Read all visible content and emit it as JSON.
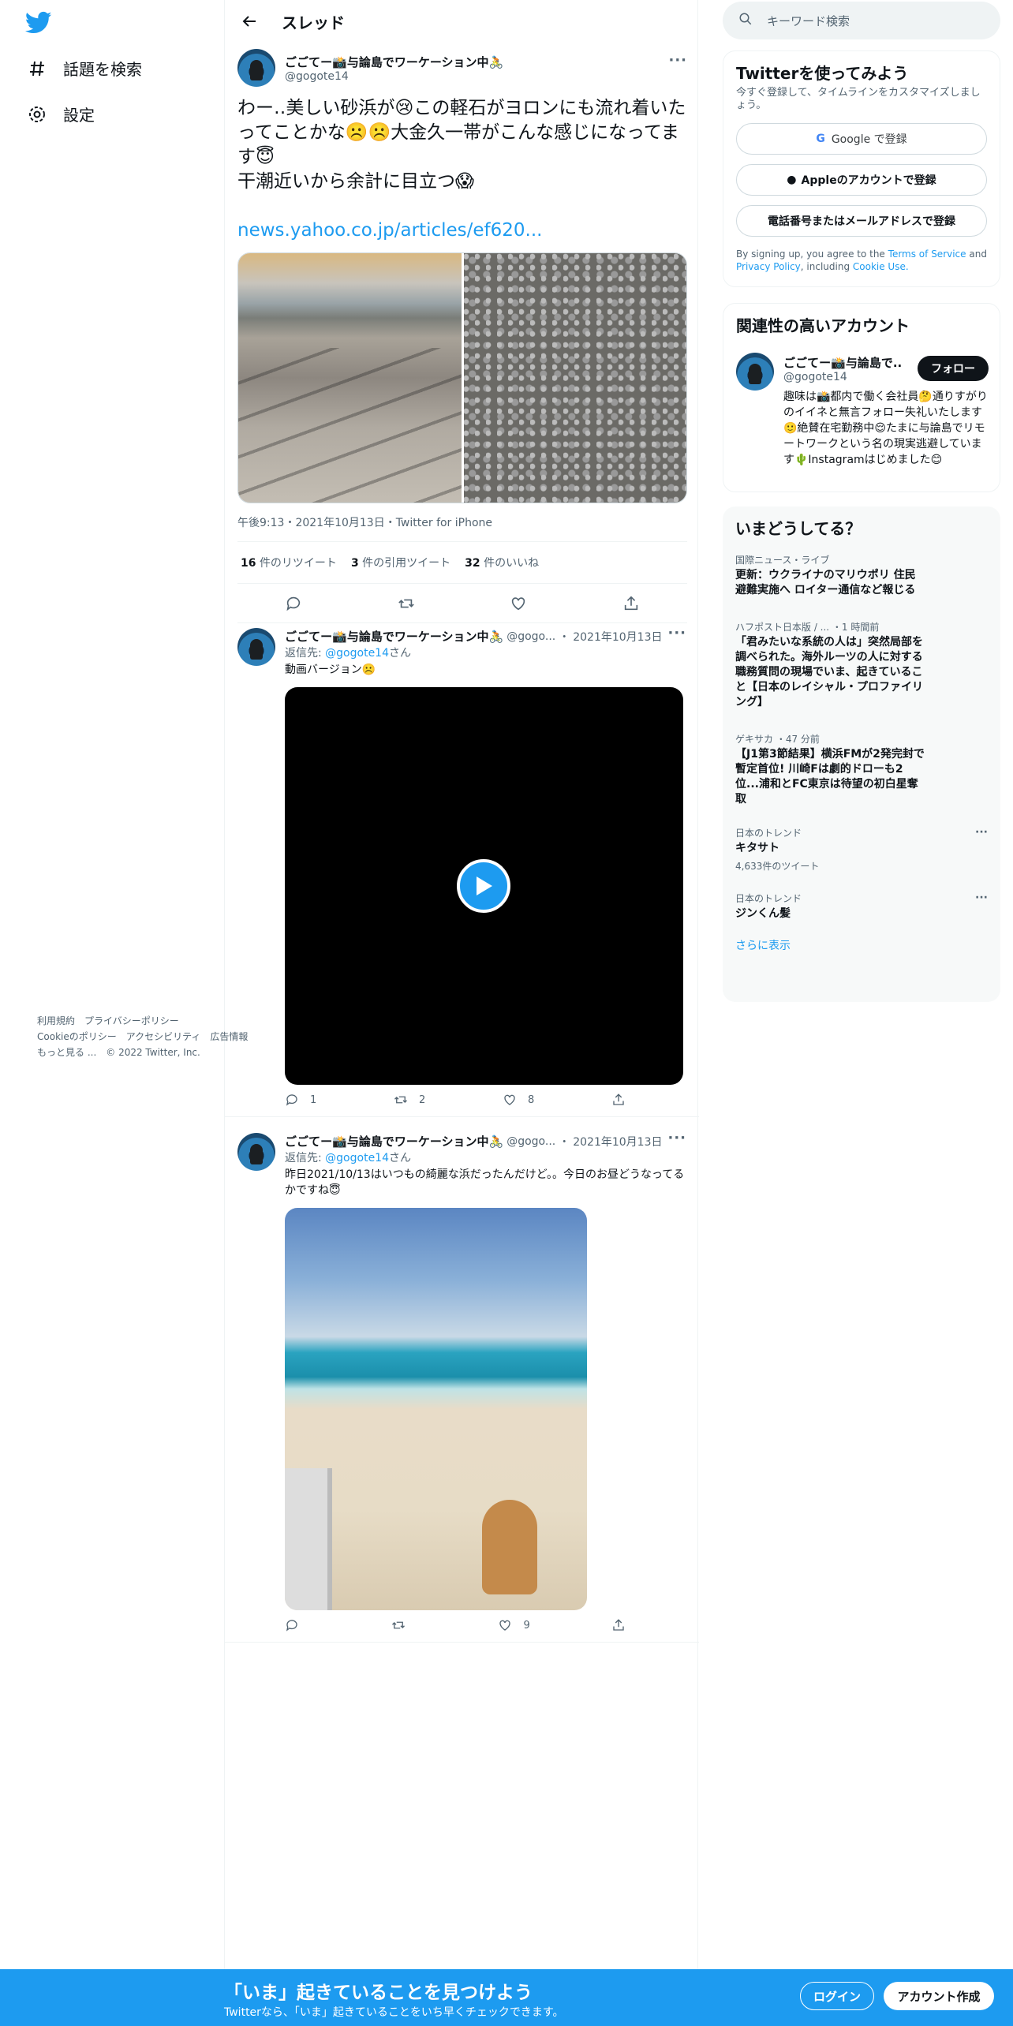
{
  "nav": {
    "logo_icon": "twitter-bird-icon",
    "items": [
      {
        "icon": "hashtag-icon",
        "label": "話題を検索"
      },
      {
        "icon": "gear-icon",
        "label": "設定"
      }
    ]
  },
  "header": {
    "back_icon": "arrow-left-icon",
    "title": "スレッド"
  },
  "main_tweet": {
    "user_name": "ごごてー📸与論島でワーケーション中🚴",
    "user_handle": "@gogote14",
    "text": "わー‥美しい砂浜が😢この軽石がヨロンにも流れ着いたってことかな☹️☹️大金久一帯がこんな感じになってます😇\n干潮近いから余計に目立つ😱",
    "link": "news.yahoo.co.jp/articles/ef620...",
    "meta": "午後9:13・2021年10月13日・Twitter for iPhone",
    "retweets_count": "16",
    "retweets_label": "件のリツイート",
    "quotes_count": "3",
    "quotes_label": "件の引用ツイート",
    "likes_count": "32",
    "likes_label": "件のいいね"
  },
  "replies": [
    {
      "user_name": "ごごてー📸与論島でワーケーション中🚴",
      "handle_short": "@gogo...",
      "date": "2021年10月13日",
      "reply_prefix": "返信先:",
      "reply_to": "@gogote14",
      "reply_suffix": "さん",
      "text": "動画バージョン☹️",
      "reply_count": "1",
      "retweet_count": "2",
      "like_count": "8"
    },
    {
      "user_name": "ごごてー📸与論島でワーケーション中🚴",
      "handle_short": "@gogo...",
      "date": "2021年10月13日",
      "reply_prefix": "返信先:",
      "reply_to": "@gogote14",
      "reply_suffix": "さん",
      "text": "昨日2021/10/13はいつもの綺麗な浜だったんだけど。。今日のお昼どうなってるかですね😇",
      "reply_count": "",
      "retweet_count": "",
      "like_count": "9"
    }
  ],
  "search": {
    "placeholder": "キーワード検索"
  },
  "signup_box": {
    "title": "Twitterを使ってみよう",
    "note": "今すぐ登録して、タイムラインをカスタマイズしましょう。",
    "google": "Google で登録",
    "apple": "Appleのアカウントで登録",
    "phone": "電話番号またはメールアドレスで登録",
    "terms_1": "By signing up, you agree to the",
    "terms_link": "Terms of Service",
    "terms_2": "and",
    "privacy_link": "Privacy Policy",
    "terms_3": ", including",
    "cookie_link": "Cookie Use."
  },
  "related": {
    "title": "関連性の高いアカウント",
    "name": "ごごてー📸与論島で...",
    "handle": "@gogote14",
    "follow": "フォロー",
    "bio": "趣味は📸都内で働く会社員🤔通りすがりのイイネと無言フォロー失礼いたします🙂絶賛在宅勤務中😌たまに与論島でリモートワークという名の現実逃避しています🌵Instagramはじめました😊"
  },
  "trends": {
    "title": "いまどうしてる？",
    "items": [
      {
        "category": "国際ニュース・ライブ",
        "text": "更新：ウクライナのマリウポリ 住民避難実施へ ロイター通信など報じる",
        "count": ""
      },
      {
        "category": "ハフポスト日本版 / ... ・1 時間前",
        "text": "「君みたいな系統の人は」突然局部を調べられた。海外ルーツの人に対する職務質問の現場でいま、起きていること【日本のレイシャル・プロファイリング】",
        "count": ""
      },
      {
        "category": "ゲキサカ ・47 分前",
        "text": "【J1第3節結果】横浜FMが2発完封で暫定首位! 川崎Fは劇的ドローも2位...浦和とFC東京は待望の初白星奪取",
        "count": ""
      },
      {
        "category": "日本のトレンド",
        "text": "キタサト",
        "count": "4,633件のツイート"
      },
      {
        "category": "日本のトレンド",
        "text": "ジンくん髪",
        "count": ""
      }
    ],
    "show_more": "さらに表示"
  },
  "footer": [
    "利用規約",
    "プライバシーポリシー",
    "Cookieのポリシー",
    "アクセシビリティ",
    "広告情報",
    "もっと見る ...",
    "© 2022 Twitter, Inc."
  ],
  "bottom_bar": {
    "title": "「いま」起きていることを見つけよう",
    "subtitle": "Twitterなら、「いま」起きていることをいち早くチェックできます。",
    "login": "ログイン",
    "signup": "アカウント作成"
  },
  "colors": {
    "accent": "#1d9bf0",
    "text": "#0f1419",
    "muted": "#536471"
  }
}
